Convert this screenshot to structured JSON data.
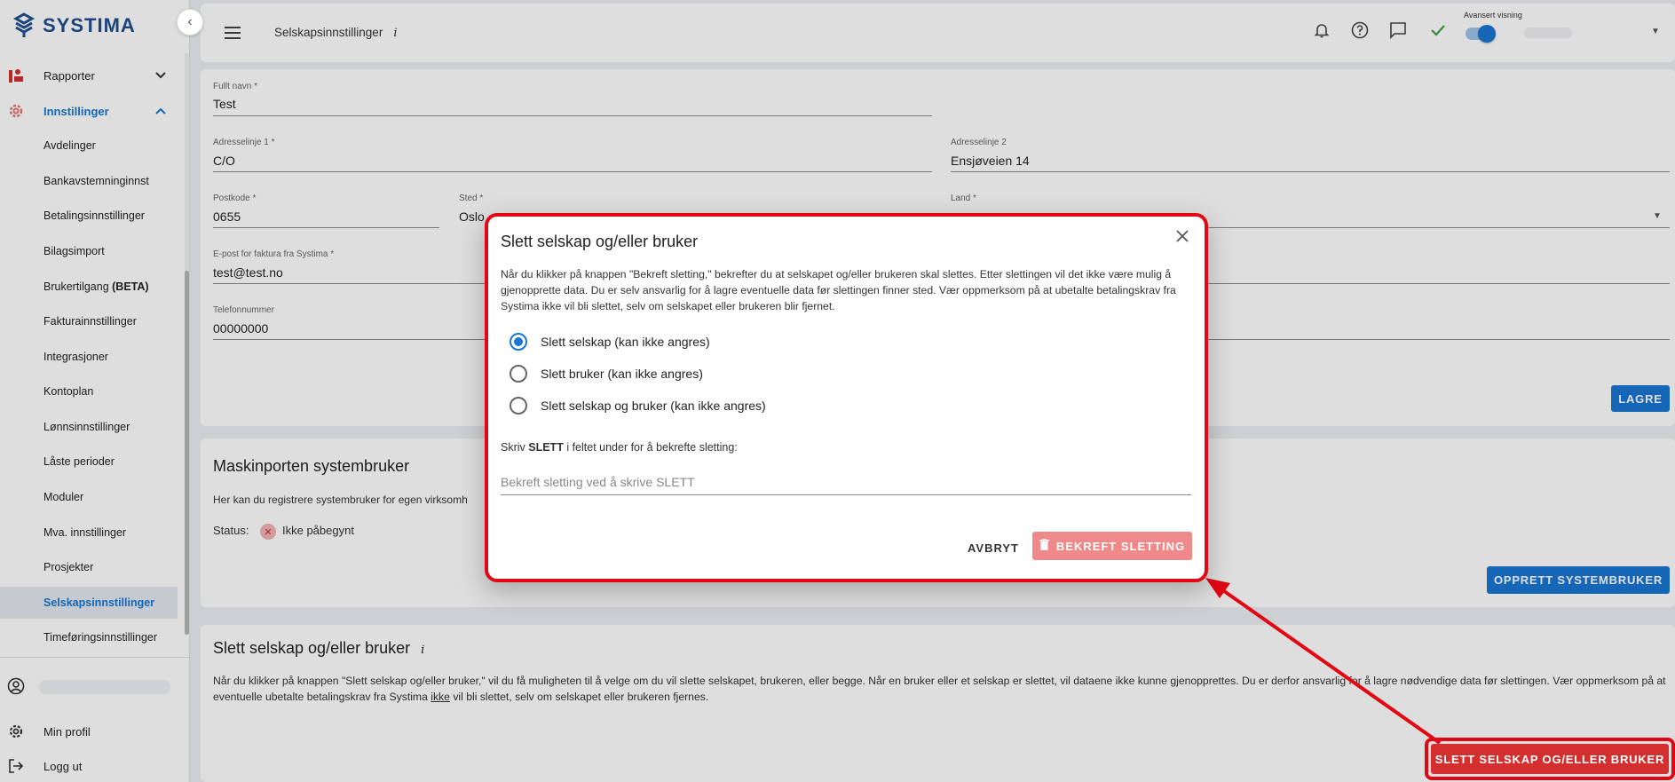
{
  "brand": {
    "logo_text": "SYSTIMA"
  },
  "sidebar": {
    "groups": [
      {
        "label": "Rapporter",
        "icon": "report-chart-icon"
      },
      {
        "label": "Innstillinger",
        "icon": "gear-icon"
      }
    ],
    "items": [
      {
        "label": "Avdelinger"
      },
      {
        "label": "Bankavstemninginnst"
      },
      {
        "label": "Betalingsinnstillinger"
      },
      {
        "label": "Bilagsimport"
      },
      {
        "label": "Brukertilgang",
        "suffix": "(BETA)"
      },
      {
        "label": "Fakturainnstillinger"
      },
      {
        "label": "Integrasjoner"
      },
      {
        "label": "Kontoplan"
      },
      {
        "label": "Lønnsinnstillinger"
      },
      {
        "label": "Låste perioder"
      },
      {
        "label": "Moduler"
      },
      {
        "label": "Mva. innstillinger"
      },
      {
        "label": "Prosjekter"
      },
      {
        "label": "Selskapsinnstillinger"
      },
      {
        "label": "Timeføringsinnstillinger"
      }
    ],
    "bottom": [
      {
        "label": "Min profil",
        "icon": "gear-icon"
      },
      {
        "label": "Logg ut",
        "icon": "logout-icon"
      }
    ]
  },
  "topbar": {
    "title": "Selskapsinnstillinger",
    "info": "i",
    "advanced_label": "Avansert visning"
  },
  "form": {
    "full_name": {
      "label": "Fullt navn *",
      "value": "Test"
    },
    "address1": {
      "label": "Adresselinje 1 *",
      "value": "C/O"
    },
    "address2": {
      "label": "Adresselinje 2",
      "value": "Ensjøveien 14"
    },
    "postcode": {
      "label": "Postkode *",
      "value": "0655"
    },
    "city": {
      "label": "Sted *",
      "value": "Oslo"
    },
    "country": {
      "label": "Land *"
    },
    "email": {
      "label": "E-post for faktura fra Systima *",
      "value": "test@test.no"
    },
    "phone": {
      "label": "Telefonnummer",
      "value": "00000000"
    },
    "save_button": "LAGRE"
  },
  "maskinporten": {
    "title": "Maskinporten systembruker",
    "description": "Her kan du registrere systembruker for egen virksomh",
    "status_label": "Status:",
    "status_value": "Ikke påbegynt",
    "create_button": "OPPRETT SYSTEMBRUKER"
  },
  "delete_section": {
    "title": "Slett selskap og/eller bruker",
    "info": "i",
    "text_part1": "Når du klikker på knappen \"Slett selskap og/eller bruker,\" vil du få muligheten til å velge om du vil slette selskapet, brukeren, eller begge. Når en bruker eller et selskap er slettet, vil dataene ikke kunne gjenopprettes. Du er derfor ansvarlig for å lagre nødvendige data før slettingen. Vær oppmerksom på at eventuelle ubetalte betalingskrav fra Systima ",
    "text_emph": "ikke",
    "text_part2": " vil bli slettet, selv om selskapet eller brukeren fjernes.",
    "button": "SLETT SELSKAP OG/ELLER BRUKER"
  },
  "modal": {
    "title": "Slett selskap og/eller bruker",
    "body": "Når du klikker på knappen \"Bekreft sletting,\" bekrefter du at selskapet og/eller brukeren skal slettes. Etter slettingen vil det ikke være mulig å gjenopprette data. Du er selv ansvarlig for å lagre eventuelle data før slettingen finner sted. Vær oppmerksom på at ubetalte betalingskrav fra Systima ikke vil bli slettet, selv om selskapet eller brukeren blir fjernet.",
    "options": [
      {
        "label": "Slett selskap (kan ikke angres)",
        "checked": true
      },
      {
        "label": "Slett bruker (kan ikke angres)",
        "checked": false
      },
      {
        "label": "Slett selskap og bruker (kan ikke angres)",
        "checked": false
      }
    ],
    "confirm_prefix": "Skriv ",
    "confirm_keyword": "SLETT",
    "confirm_suffix": " i feltet under for å bekrefte sletting:",
    "input_placeholder": "Bekreft sletting ved å skrive SLETT",
    "cancel": "AVBRYT",
    "confirm_button": "BEKREFT SLETTING"
  },
  "colors": {
    "primary": "#1976d2",
    "danger": "#d32f2f",
    "danger_disabled": "#f08a8a",
    "highlight": "#e30613"
  }
}
